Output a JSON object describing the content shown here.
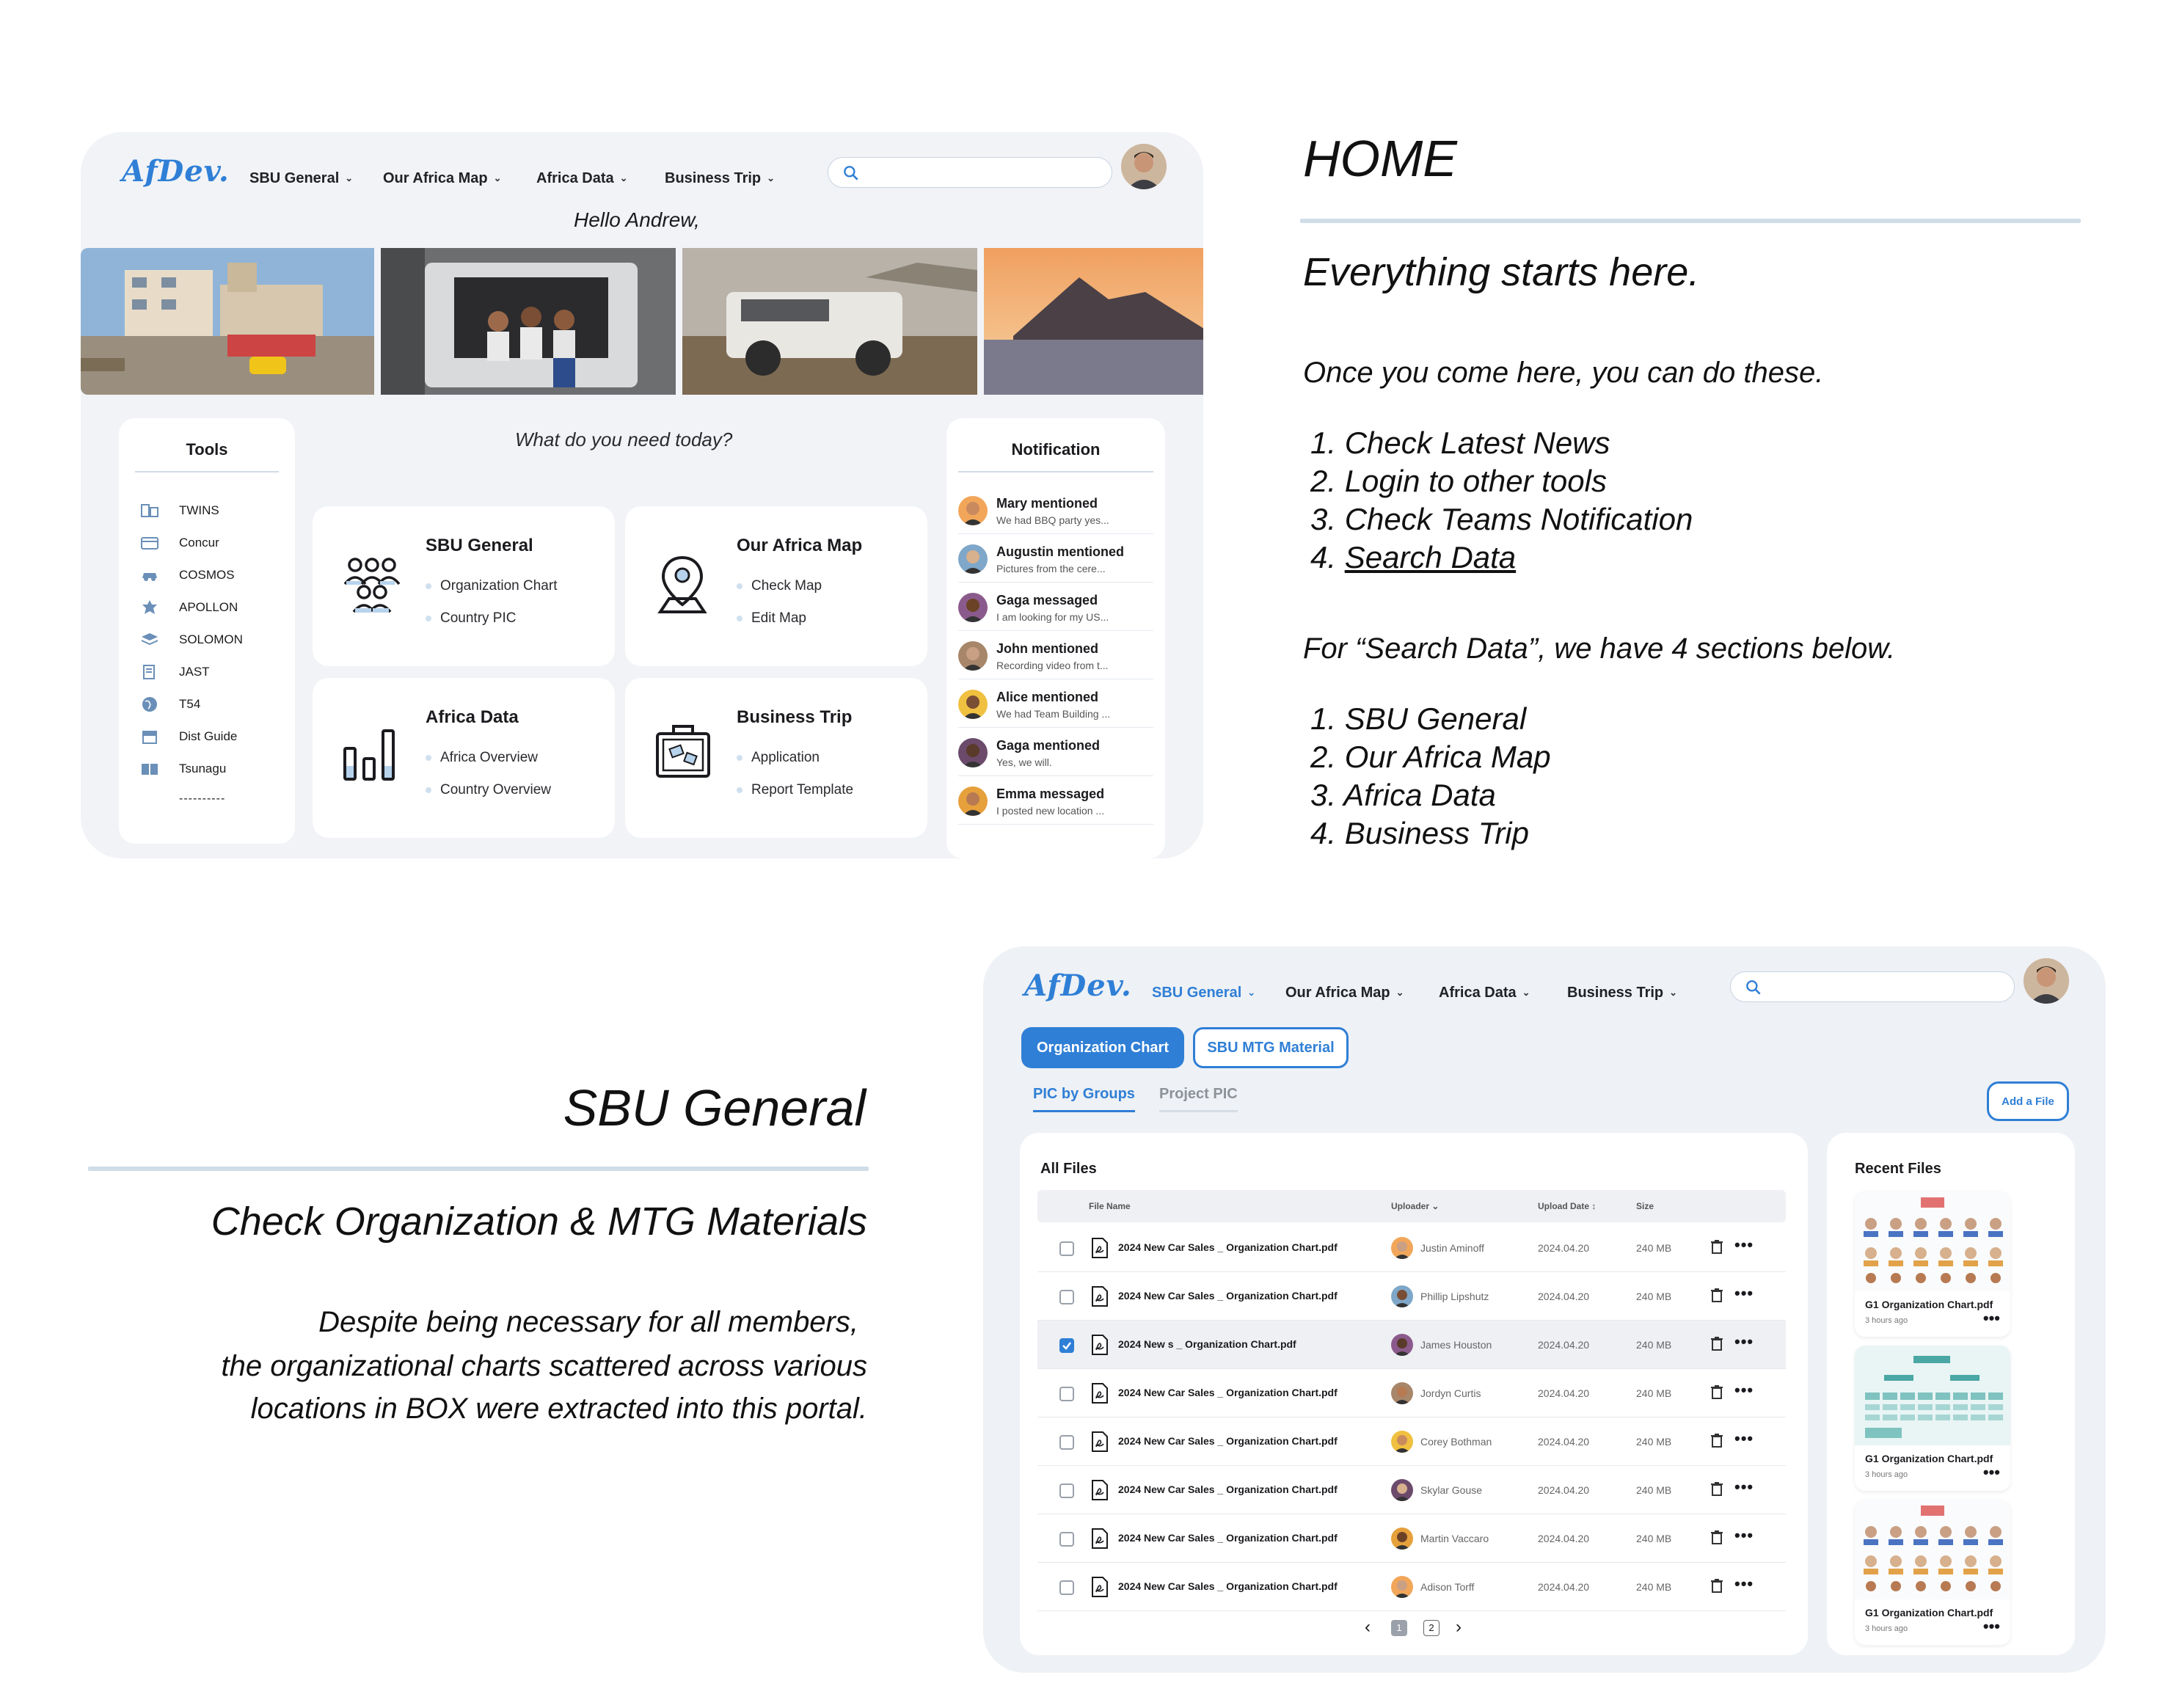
{
  "home_mock": {
    "logo": "AfDev.",
    "nav": [
      "SBU General",
      "Our Africa Map",
      "Africa Data",
      "Business Trip"
    ],
    "greeting": "Hello Andrew,",
    "prompt": "What do you need today?",
    "tools": {
      "title": "Tools",
      "items": [
        "TWINS",
        "Concur",
        "COSMOS",
        "APOLLON",
        "SOLOMON",
        "JAST",
        "T54",
        "Dist Guide",
        "Tsunagu"
      ],
      "more": "----------"
    },
    "cards": [
      {
        "title": "SBU General",
        "links": [
          "Organization Chart",
          "Country PIC"
        ],
        "icon": "people-group-icon"
      },
      {
        "title": "Our Africa Map",
        "links": [
          "Check Map",
          "Edit Map"
        ],
        "icon": "map-pin-icon"
      },
      {
        "title": "Africa Data",
        "links": [
          "Africa Overview",
          "Country Overview"
        ],
        "icon": "bar-chart-icon"
      },
      {
        "title": "Business Trip",
        "links": [
          "Application",
          "Report Template"
        ],
        "icon": "suitcase-icon"
      }
    ],
    "notifications": {
      "title": "Notification",
      "items": [
        {
          "title": "Mary mentioned",
          "text": "We had BBQ party yes..."
        },
        {
          "title": "Augustin mentioned",
          "text": "Pictures from the cere..."
        },
        {
          "title": "Gaga messaged",
          "text": "I am looking for my US..."
        },
        {
          "title": "John mentioned",
          "text": "Recording video from t..."
        },
        {
          "title": "Alice mentioned",
          "text": "We had Team Building ..."
        },
        {
          "title": "Gaga mentioned",
          "text": "Yes, we will."
        },
        {
          "title": "Emma messaged",
          "text": "I posted new location ..."
        }
      ]
    }
  },
  "home_text": {
    "heading": "HOME",
    "tagline": "Everything starts here.",
    "intro": "Once you come here, you can do these.",
    "list1": [
      "1. Check Latest News",
      "2. Login to other tools",
      "3. Check Teams Notification"
    ],
    "list1_last_num": "4.",
    "list1_last_link": "Search Data",
    "sections_intro": "For “Search Data”, we have 4 sections below.",
    "list2": [
      "1. SBU General",
      "2. Our Africa Map",
      "3. Africa Data",
      "4. Business Trip"
    ]
  },
  "sbu_text": {
    "heading": "SBU General",
    "tagline": "Check Organization & MTG Materials",
    "body": [
      "Despite being necessary for all members,",
      "the organizational charts scattered across various",
      "locations in BOX were extracted into this portal."
    ]
  },
  "files_mock": {
    "logo": "AfDev.",
    "nav": [
      "SBU General",
      "Our Africa Map",
      "Africa Data",
      "Business Trip"
    ],
    "active_nav": "SBU General",
    "buttons": {
      "org_chart": "Organization Chart",
      "mtg_material": "SBU MTG Material",
      "add_file": "Add a File"
    },
    "tabs": [
      "PIC by Groups",
      "Project PIC"
    ],
    "all_files": {
      "title": "All Files",
      "columns": [
        "File Name",
        "Uploader",
        "Upload Date",
        "Size"
      ],
      "rows": [
        {
          "name": "2024 New Car Sales _ Organization Chart.pdf",
          "uploader": "Justin Aminoff",
          "date": "2024.04.20",
          "size": "240 MB",
          "checked": false
        },
        {
          "name": "2024 New Car Sales _ Organization Chart.pdf",
          "uploader": "Phillip Lipshutz",
          "date": "2024.04.20",
          "size": "240 MB",
          "checked": false
        },
        {
          "name": "2024 New s _ Organization Chart.pdf",
          "uploader": "James Houston",
          "date": "2024.04.20",
          "size": "240 MB",
          "checked": true
        },
        {
          "name": "2024 New Car Sales _ Organization Chart.pdf",
          "uploader": "Jordyn Curtis",
          "date": "2024.04.20",
          "size": "240 MB",
          "checked": false
        },
        {
          "name": "2024 New Car Sales _ Organization Chart.pdf",
          "uploader": "Corey Bothman",
          "date": "2024.04.20",
          "size": "240 MB",
          "checked": false
        },
        {
          "name": "2024 New Car Sales _ Organization Chart.pdf",
          "uploader": "Skylar Gouse",
          "date": "2024.04.20",
          "size": "240 MB",
          "checked": false
        },
        {
          "name": "2024 New Car Sales _ Organization Chart.pdf",
          "uploader": "Martin Vaccaro",
          "date": "2024.04.20",
          "size": "240 MB",
          "checked": false
        },
        {
          "name": "2024 New Car Sales _ Organization Chart.pdf",
          "uploader": "Adison Torff",
          "date": "2024.04.20",
          "size": "240 MB",
          "checked": false
        }
      ],
      "pages": [
        "1",
        "2"
      ],
      "current_page": "1"
    },
    "recent_files": {
      "title": "Recent Files",
      "items": [
        {
          "name": "G1 Organization Chart.pdf",
          "time": "3 hours ago"
        },
        {
          "name": "G1 Organization Chart.pdf",
          "time": "3 hours ago"
        },
        {
          "name": "G1 Organization Chart.pdf",
          "time": "3 hours ago"
        }
      ]
    }
  },
  "colors": {
    "accent": "#2f7fd6",
    "panel": "#f1f3f6",
    "rule": "#cfdde9"
  }
}
